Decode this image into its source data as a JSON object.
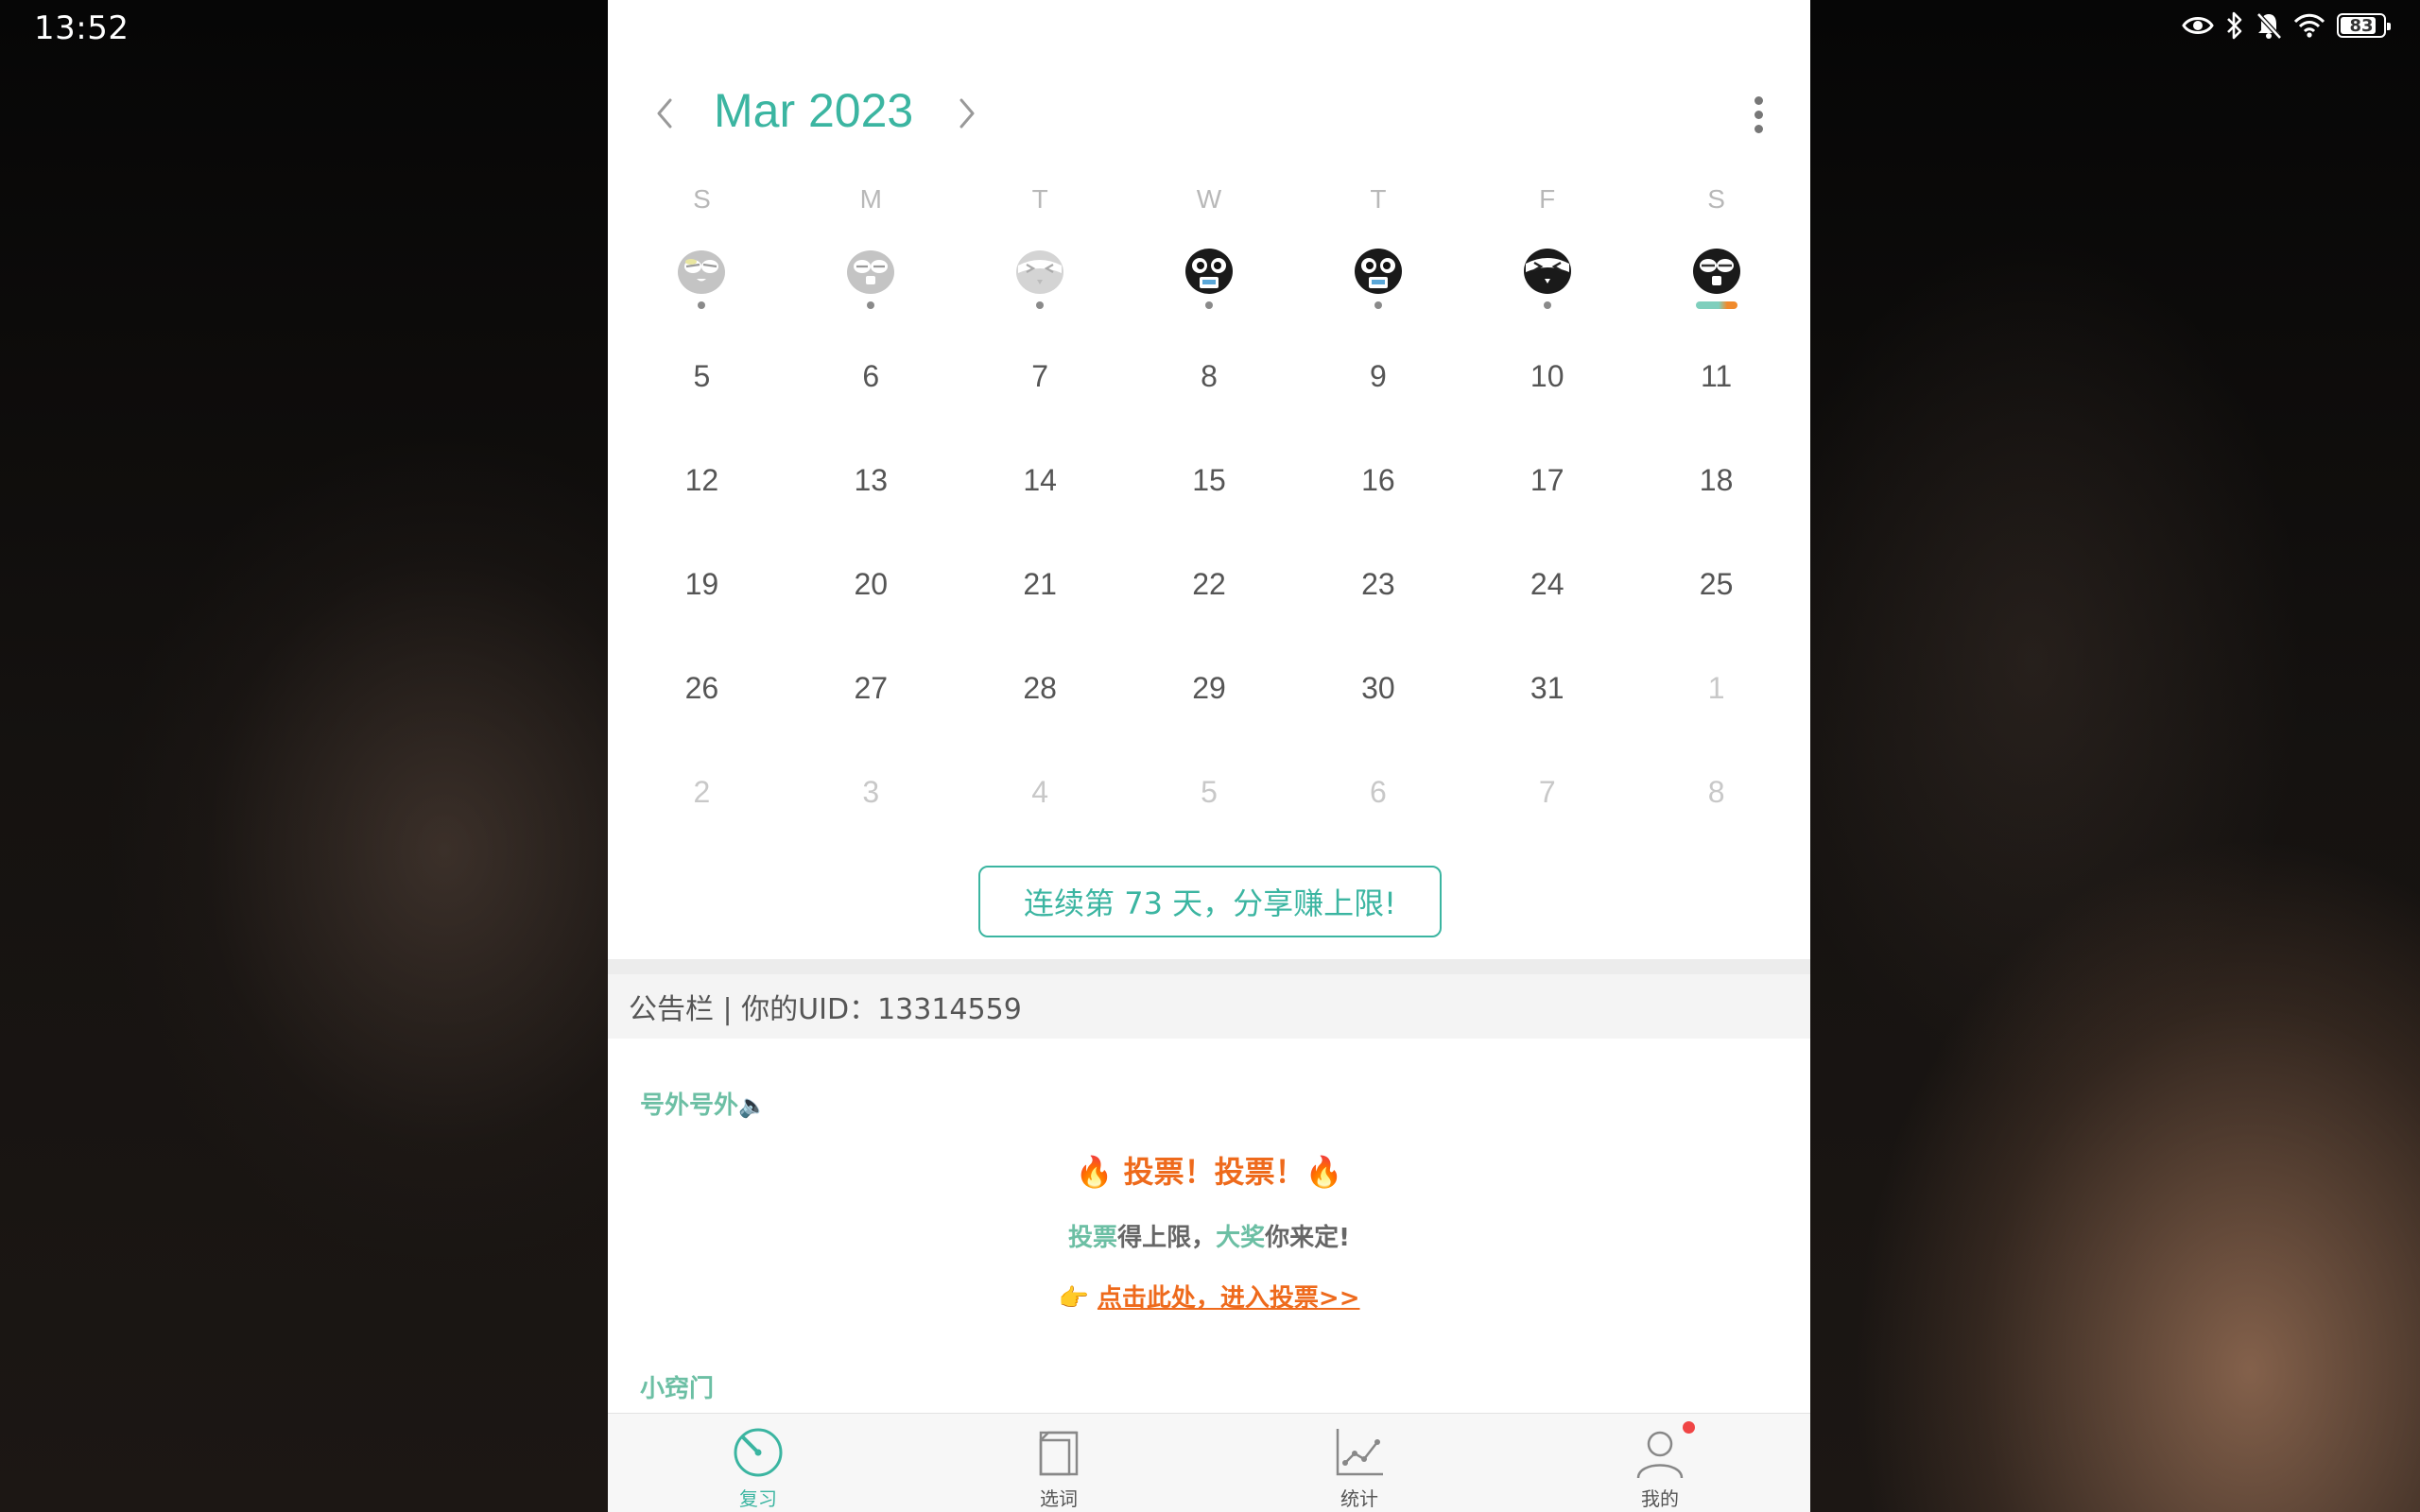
{
  "status_bar": {
    "time": "13:52",
    "battery": "83",
    "battery_level": 0.83,
    "icons": [
      "eye-icon",
      "bluetooth-icon",
      "bell-off-icon",
      "wifi-icon",
      "battery-icon"
    ]
  },
  "calendar": {
    "month_title": "Mar 2023",
    "weekdays": [
      "S",
      "M",
      "T",
      "W",
      "T",
      "F",
      "S"
    ],
    "face_row": [
      {
        "icon": "owl-sleepy-gray",
        "marker": "dot"
      },
      {
        "icon": "owl-gray",
        "marker": "dot"
      },
      {
        "icon": "owl-squint-gray",
        "marker": "dot"
      },
      {
        "icon": "owl-black-book",
        "marker": "dot"
      },
      {
        "icon": "owl-black-book",
        "marker": "dot"
      },
      {
        "icon": "owl-squint-black",
        "marker": "dot"
      },
      {
        "icon": "owl-black",
        "marker": "progress-bar"
      }
    ],
    "weeks": [
      [
        "5",
        "6",
        "7",
        "8",
        "9",
        "10",
        "11"
      ],
      [
        "12",
        "13",
        "14",
        "15",
        "16",
        "17",
        "18"
      ],
      [
        "19",
        "20",
        "21",
        "22",
        "23",
        "24",
        "25"
      ],
      [
        "26",
        "27",
        "28",
        "29",
        "30",
        "31",
        "1"
      ],
      [
        "2",
        "3",
        "4",
        "5",
        "6",
        "7",
        "8"
      ]
    ],
    "share_button": "连续第 73 天，分享赚上限!"
  },
  "notice": {
    "header": "公告栏 | 你的UID：13314559",
    "section1_title": "号外号外",
    "vote_title": "🔥 投票！投票！🔥",
    "vote_line_part1": "投票",
    "vote_line_part2": "得上限，",
    "vote_line_part3": "大奖",
    "vote_line_part4": "你来定!",
    "vote_pointer": "👉",
    "vote_link": "点击此处，进入投票>>",
    "section2_title": "小窍门"
  },
  "tabbar": {
    "tabs": [
      {
        "label": "复习",
        "icon": "review-dial-icon",
        "active": true
      },
      {
        "label": "选词",
        "icon": "book-icon",
        "active": false
      },
      {
        "label": "统计",
        "icon": "chart-icon",
        "active": false
      },
      {
        "label": "我的",
        "icon": "user-icon",
        "active": false
      }
    ]
  },
  "colors": {
    "accent": "#3bb5a1",
    "vote_orange": "#ee6a1c",
    "highlight_green": "#6cbfa4",
    "badge_red": "#f04545"
  }
}
